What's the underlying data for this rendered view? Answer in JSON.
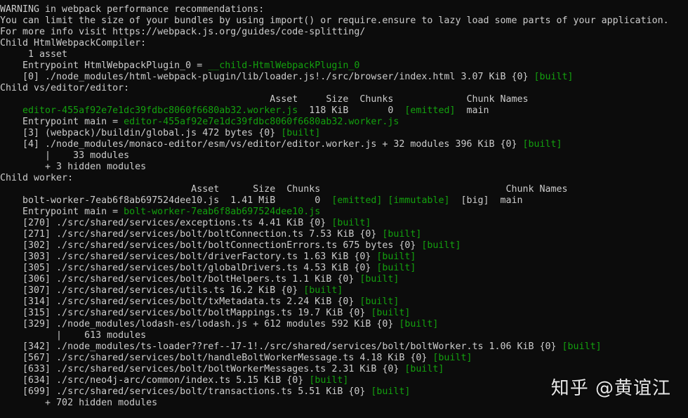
{
  "lines": [
    [
      {
        "t": "WARNING in webpack performance recommendations:",
        "c": "white"
      }
    ],
    [
      {
        "t": "You can limit the size of your bundles by using import() or require.ensure to lazy load some parts of your application.",
        "c": "white"
      }
    ],
    [
      {
        "t": "For more info visit https://webpack.js.org/guides/code-splitting/",
        "c": "white"
      }
    ],
    [
      {
        "t": "Child HtmlWebpackCompiler:",
        "c": "white"
      }
    ],
    [
      {
        "t": "     1 asset",
        "c": "white"
      }
    ],
    [
      {
        "t": "    Entrypoint HtmlWebpackPlugin_0 = ",
        "c": "white"
      },
      {
        "t": "__child-HtmlWebpackPlugin_0",
        "c": "green"
      }
    ],
    [
      {
        "t": "    [0] ./node_modules/html-webpack-plugin/lib/loader.js!./src/browser/index.html 3.07 KiB {0} ",
        "c": "white"
      },
      {
        "t": "[built]",
        "c": "green"
      }
    ],
    [
      {
        "t": "Child vs/editor/editor:",
        "c": "white"
      }
    ],
    [
      {
        "t": "                                                Asset     Size  Chunks             Chunk Names",
        "c": "white"
      }
    ],
    [
      {
        "t": "    ",
        "c": "white"
      },
      {
        "t": "editor-455af92e7e1dc39fdbc8060f6680ab32.worker.js",
        "c": "green"
      },
      {
        "t": "  118 KiB       0  ",
        "c": "white"
      },
      {
        "t": "[emitted]",
        "c": "green"
      },
      {
        "t": "  main",
        "c": "white"
      }
    ],
    [
      {
        "t": "    Entrypoint main = ",
        "c": "white"
      },
      {
        "t": "editor-455af92e7e1dc39fdbc8060f6680ab32.worker.js",
        "c": "green"
      }
    ],
    [
      {
        "t": "    [3] (webpack)/buildin/global.js 472 bytes {0} ",
        "c": "white"
      },
      {
        "t": "[built]",
        "c": "green"
      }
    ],
    [
      {
        "t": "    [4] ./node_modules/monaco-editor/esm/vs/editor/editor.worker.js + 32 modules 396 KiB {0} ",
        "c": "white"
      },
      {
        "t": "[built]",
        "c": "green"
      }
    ],
    [
      {
        "t": "        |    33 modules",
        "c": "white"
      }
    ],
    [
      {
        "t": "        + 3 hidden modules",
        "c": "white"
      }
    ],
    [
      {
        "t": "Child worker:",
        "c": "white"
      }
    ],
    [
      {
        "t": "                                  Asset      Size  Chunks                                 Chunk Names",
        "c": "white"
      }
    ],
    [
      {
        "t": "    bolt-worker-7eab6f8ab697524dee10.js  1.41 MiB       0  ",
        "c": "white"
      },
      {
        "t": "[emitted]",
        "c": "green"
      },
      {
        "t": " ",
        "c": "white"
      },
      {
        "t": "[immutable]",
        "c": "green"
      },
      {
        "t": "  [big]  main",
        "c": "white"
      }
    ],
    [
      {
        "t": "    Entrypoint main = ",
        "c": "white"
      },
      {
        "t": "bolt-worker-7eab6f8ab697524dee10.js",
        "c": "green"
      }
    ],
    [
      {
        "t": "    [270] ./src/shared/services/exceptions.ts 4.41 KiB {0} ",
        "c": "white"
      },
      {
        "t": "[built]",
        "c": "green"
      }
    ],
    [
      {
        "t": "    [271] ./src/shared/services/bolt/boltConnection.ts 7.53 KiB {0} ",
        "c": "white"
      },
      {
        "t": "[built]",
        "c": "green"
      }
    ],
    [
      {
        "t": "    [302] ./src/shared/services/bolt/boltConnectionErrors.ts 675 bytes {0} ",
        "c": "white"
      },
      {
        "t": "[built]",
        "c": "green"
      }
    ],
    [
      {
        "t": "    [303] ./src/shared/services/bolt/driverFactory.ts 1.63 KiB {0} ",
        "c": "white"
      },
      {
        "t": "[built]",
        "c": "green"
      }
    ],
    [
      {
        "t": "    [305] ./src/shared/services/bolt/globalDrivers.ts 4.53 KiB {0} ",
        "c": "white"
      },
      {
        "t": "[built]",
        "c": "green"
      }
    ],
    [
      {
        "t": "    [306] ./src/shared/services/bolt/boltHelpers.ts 1.1 KiB {0} ",
        "c": "white"
      },
      {
        "t": "[built]",
        "c": "green"
      }
    ],
    [
      {
        "t": "    [307] ./src/shared/services/utils.ts 16.2 KiB {0} ",
        "c": "white"
      },
      {
        "t": "[built]",
        "c": "green"
      }
    ],
    [
      {
        "t": "    [314] ./src/shared/services/bolt/txMetadata.ts 2.24 KiB {0} ",
        "c": "white"
      },
      {
        "t": "[built]",
        "c": "green"
      }
    ],
    [
      {
        "t": "    [315] ./src/shared/services/bolt/boltMappings.ts 19.7 KiB {0} ",
        "c": "white"
      },
      {
        "t": "[built]",
        "c": "green"
      }
    ],
    [
      {
        "t": "    [329] ./node_modules/lodash-es/lodash.js + 612 modules 592 KiB {0} ",
        "c": "white"
      },
      {
        "t": "[built]",
        "c": "green"
      }
    ],
    [
      {
        "t": "          |    613 modules",
        "c": "white"
      }
    ],
    [
      {
        "t": "    [342] ./node_modules/ts-loader??ref--17-1!./src/shared/services/bolt/boltWorker.ts 1.06 KiB {0} ",
        "c": "white"
      },
      {
        "t": "[built]",
        "c": "green"
      }
    ],
    [
      {
        "t": "    [567] ./src/shared/services/bolt/handleBoltWorkerMessage.ts 4.18 KiB {0} ",
        "c": "white"
      },
      {
        "t": "[built]",
        "c": "green"
      }
    ],
    [
      {
        "t": "    [633] ./src/shared/services/bolt/boltWorkerMessages.ts 2.31 KiB {0} ",
        "c": "white"
      },
      {
        "t": "[built]",
        "c": "green"
      }
    ],
    [
      {
        "t": "    [634] ./src/neo4j-arc/common/index.ts 5.15 KiB {0} ",
        "c": "white"
      },
      {
        "t": "[built]",
        "c": "green"
      }
    ],
    [
      {
        "t": "    [699] ./src/shared/services/bolt/transactions.ts 5.51 KiB {0} ",
        "c": "white"
      },
      {
        "t": "[built]",
        "c": "green"
      }
    ],
    [
      {
        "t": "        + 702 hidden modules",
        "c": "white"
      }
    ]
  ],
  "watermark": "知乎 @黄谊江",
  "colors": {
    "background": "#0c0c0c",
    "text": "#cccccc",
    "success": "#13a10e"
  }
}
